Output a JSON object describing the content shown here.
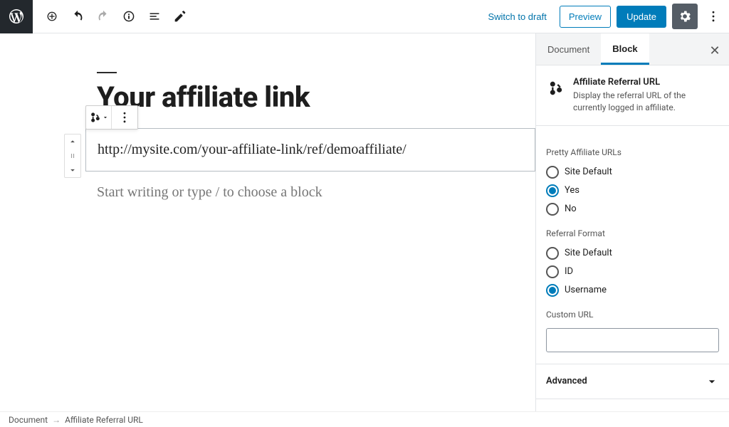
{
  "topbar": {
    "switch_draft": "Switch to draft",
    "preview": "Preview",
    "update": "Update"
  },
  "document": {
    "title": "Your affiliate link",
    "affiliate_url": "http://mysite.com/your-affiliate-link/ref/demoaffiliate/",
    "placeholder": "Start writing or type / to choose a block"
  },
  "sidebar": {
    "tabs": {
      "document": "Document",
      "block": "Block"
    },
    "block_card": {
      "title": "Affiliate Referral URL",
      "description": "Display the referral URL of the currently logged in affiliate."
    },
    "pretty_urls": {
      "label": "Pretty Affiliate URLs",
      "options": [
        "Site Default",
        "Yes",
        "No"
      ],
      "selected": "Yes"
    },
    "referral_format": {
      "label": "Referral Format",
      "options": [
        "Site Default",
        "ID",
        "Username"
      ],
      "selected": "Username"
    },
    "custom_url": {
      "label": "Custom URL",
      "value": ""
    },
    "advanced": "Advanced"
  },
  "breadcrumb": {
    "root": "Document",
    "current": "Affiliate Referral URL"
  }
}
